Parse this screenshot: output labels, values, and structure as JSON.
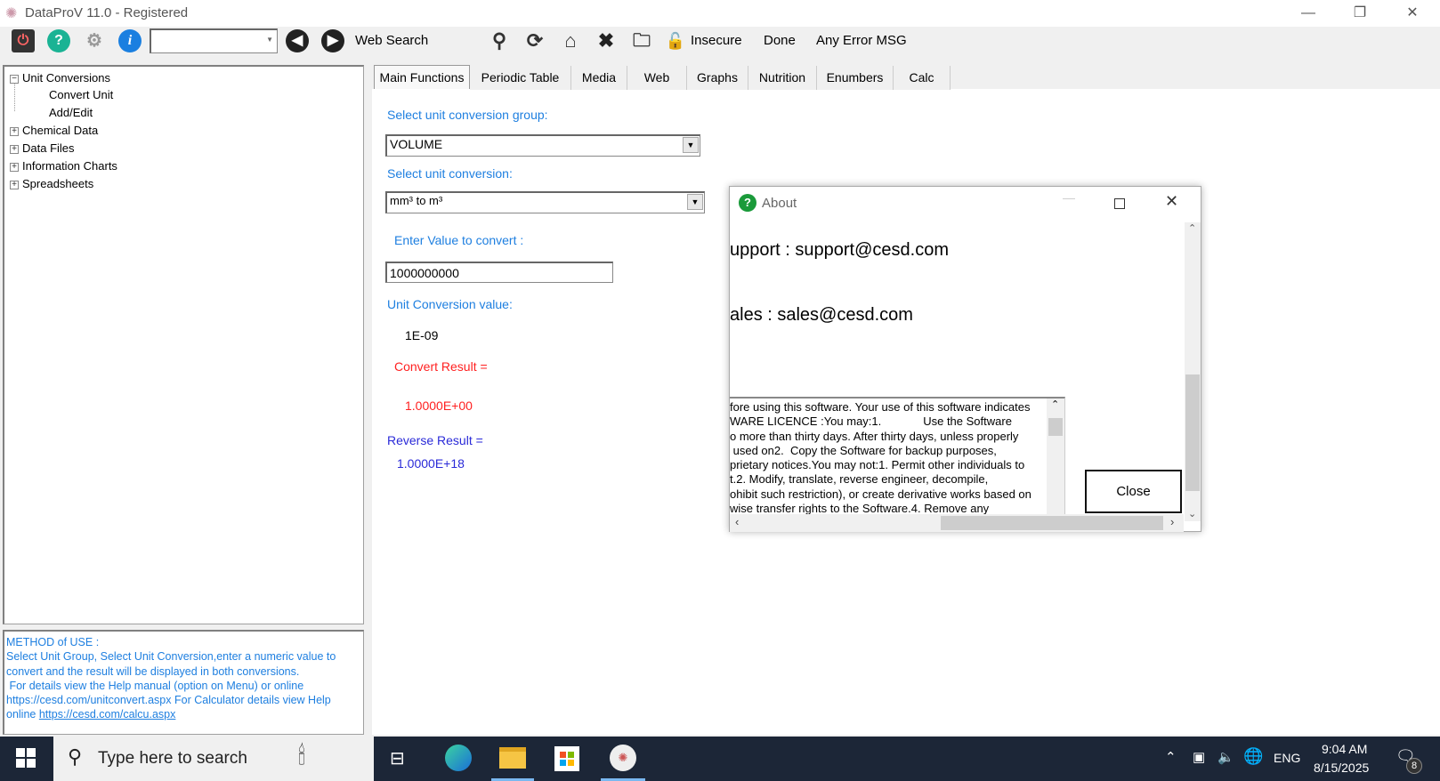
{
  "window": {
    "title": "DataProV 11.0 - Registered",
    "minimize": "—",
    "restore": "❐",
    "close": "✕"
  },
  "toolbar": {
    "combo_value": "",
    "web_search": "Web Search",
    "insecure": "Insecure",
    "done": "Done",
    "error": "Any Error MSG"
  },
  "tree": {
    "items": [
      {
        "label": "Unit Conversions",
        "expander": "−"
      },
      {
        "label": "Convert Unit"
      },
      {
        "label": "Add/Edit"
      },
      {
        "label": "Chemical Data",
        "expander": "+"
      },
      {
        "label": "Data Files",
        "expander": "+"
      },
      {
        "label": "Information Charts",
        "expander": "+"
      },
      {
        "label": "Spreadsheets",
        "expander": "+"
      }
    ]
  },
  "method": {
    "heading": "METHOD of USE :",
    "line1": "Select Unit Group, Select Unit Conversion,enter a numeric value to",
    "line2": "convert and the result will be displayed in both conversions.",
    "line3": " For details view the Help manual (option on Menu) or online",
    "link1": "https://cesd.com/unitconvert.aspx",
    "line4": " For Calculator details view Help",
    "line5": "online ",
    "link2": "https://cesd.com/calcu.aspx"
  },
  "tabs": [
    "Main Functions",
    "Periodic Table",
    "Media",
    "Web",
    "Graphs",
    "Nutrition",
    "Enumbers",
    "Calc"
  ],
  "main": {
    "group_label": "Select unit conversion group:",
    "group_value": "VOLUME",
    "conv_label": "Select unit conversion:",
    "conv_value": "mm³ to m³",
    "enter_label": "Enter Value to convert :",
    "input_value": "1000000000",
    "ucv_label": "Unit Conversion value:",
    "ucv_value": "1E-09",
    "convert_label": "Convert Result =",
    "convert_value": "1.0000E+00",
    "reverse_label": "Reverse Result =",
    "reverse_value": "1.0000E+18"
  },
  "about": {
    "title": "About",
    "support": "upport :  support@cesd.com",
    "sales": "ales :  sales@cesd.com",
    "close": "Close",
    "licence": [
      "fore using this software. Your use of this software indicates",
      "WARE LICENCE :You may:1.             Use the Software",
      "o more than thirty days.  After thirty days, unless properly",
      " used on2.  Copy the Software for backup purposes,",
      "prietary notices.You may not:1.  Permit other individuals to",
      "t.2.  Modify, translate, reverse engineer, decompile,",
      "ohibit such restriction), or  create derivative works based on",
      "wise transfer rights  to the Software.4.  Remove any"
    ]
  },
  "taskbar": {
    "search": "Type here to search",
    "lang": "ENG",
    "time": "9:04 AM",
    "date": "8/15/2025",
    "notifications": "8"
  },
  "colors": {
    "label_blue": "#1e7fe0",
    "result_red": "#ff2020",
    "reverse_blue": "#2a2ad8",
    "taskbar": "#1c2637"
  }
}
